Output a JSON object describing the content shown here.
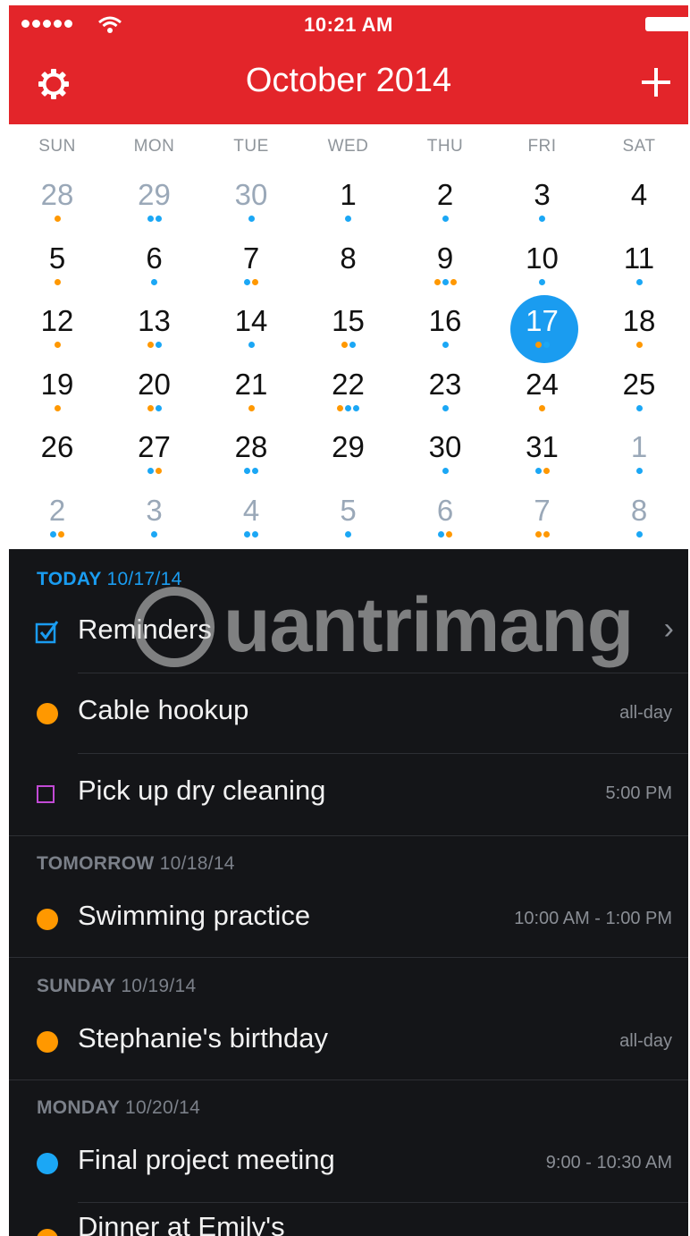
{
  "status_bar": {
    "time": "10:21 AM"
  },
  "header": {
    "title": "October 2014"
  },
  "calendar": {
    "weekdays": [
      "SUN",
      "MON",
      "TUE",
      "WED",
      "THU",
      "FRI",
      "SAT"
    ],
    "weeks": [
      [
        {
          "n": "28",
          "m": true,
          "d": "o"
        },
        {
          "n": "29",
          "m": true,
          "d": "bb"
        },
        {
          "n": "30",
          "m": true,
          "d": "b"
        },
        {
          "n": "1",
          "d": "b"
        },
        {
          "n": "2",
          "d": "b"
        },
        {
          "n": "3",
          "d": "b"
        },
        {
          "n": "4",
          "d": ""
        }
      ],
      [
        {
          "n": "5",
          "d": "o"
        },
        {
          "n": "6",
          "d": "b"
        },
        {
          "n": "7",
          "d": "bo"
        },
        {
          "n": "8",
          "d": ""
        },
        {
          "n": "9",
          "d": "obo"
        },
        {
          "n": "10",
          "d": "b"
        },
        {
          "n": "11",
          "d": "b"
        }
      ],
      [
        {
          "n": "12",
          "d": "o"
        },
        {
          "n": "13",
          "d": "ob"
        },
        {
          "n": "14",
          "d": "b"
        },
        {
          "n": "15",
          "d": "ob"
        },
        {
          "n": "16",
          "d": "b"
        },
        {
          "n": "17",
          "d": "ob",
          "today": true
        },
        {
          "n": "18",
          "d": "o"
        }
      ],
      [
        {
          "n": "19",
          "d": "o"
        },
        {
          "n": "20",
          "d": "ob"
        },
        {
          "n": "21",
          "d": "o"
        },
        {
          "n": "22",
          "d": "obb"
        },
        {
          "n": "23",
          "d": "b"
        },
        {
          "n": "24",
          "d": "o"
        },
        {
          "n": "25",
          "d": "b"
        }
      ],
      [
        {
          "n": "26",
          "d": ""
        },
        {
          "n": "27",
          "d": "bo"
        },
        {
          "n": "28",
          "d": "bb"
        },
        {
          "n": "29",
          "d": ""
        },
        {
          "n": "30",
          "d": "b"
        },
        {
          "n": "31",
          "d": "bo"
        },
        {
          "n": "1",
          "m": true,
          "d": "b"
        }
      ],
      [
        {
          "n": "2",
          "m": true,
          "d": "bo"
        },
        {
          "n": "3",
          "m": true,
          "d": "b"
        },
        {
          "n": "4",
          "m": true,
          "d": "bb"
        },
        {
          "n": "5",
          "m": true,
          "d": "b"
        },
        {
          "n": "6",
          "m": true,
          "d": "bo"
        },
        {
          "n": "7",
          "m": true,
          "d": "oo"
        },
        {
          "n": "8",
          "m": true,
          "d": "b"
        }
      ]
    ]
  },
  "agenda": {
    "today": {
      "heading": "TODAY",
      "date": "10/17/14"
    },
    "reminders": {
      "label": "Reminders"
    },
    "cable": {
      "label": "Cable hookup",
      "time": "all-day"
    },
    "dry": {
      "label": "Pick up dry cleaning",
      "time": "5:00 PM"
    },
    "tomorrow": {
      "heading": "TOMORROW",
      "date": "10/18/14"
    },
    "swim": {
      "label": "Swimming practice",
      "time": "10:00 AM - 1:00 PM"
    },
    "sunday": {
      "heading": "SUNDAY",
      "date": "10/19/14"
    },
    "birthday": {
      "label": "Stephanie's birthday",
      "time": "all-day"
    },
    "monday": {
      "heading": "MONDAY",
      "date": "10/20/14"
    },
    "meeting": {
      "label": "Final project meeting",
      "time": "9:00 - 10:30 AM"
    },
    "dinner": {
      "label": "Dinner at Emily's"
    }
  },
  "watermark": {
    "text": "uantrimang"
  },
  "colors": {
    "header": "#e3252a",
    "accent_blue": "#1a9cf0",
    "orange": "#ff9800",
    "purple": "#c24ad5",
    "agenda_bg": "#141518"
  },
  "icons": {
    "settings": "gear-icon",
    "add": "plus-icon",
    "reminders": "checkbox-icon",
    "disclosure": "chevron-right-icon"
  }
}
